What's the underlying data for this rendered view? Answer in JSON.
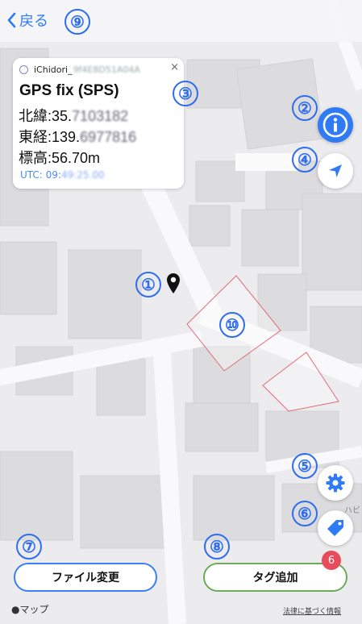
{
  "nav": {
    "back_label": "戻る"
  },
  "card": {
    "device_name": "iChidori_",
    "device_id_masked": "9f4E8D51A04A",
    "close_symbol": "×",
    "title": "GPS fix (SPS)",
    "lat_label": "北緯:",
    "lat_visible": "35.",
    "lat_masked": "7103182",
    "lon_label": "東経:",
    "lon_visible": "139.",
    "lon_masked": "6977816",
    "alt_label": "標高:",
    "alt_value": "56.70m",
    "utc_label": "UTC: 09:",
    "utc_masked": "49:25.00"
  },
  "badges": {
    "b1": "①",
    "b2": "②",
    "b3": "③",
    "b4": "④",
    "b5": "⑤",
    "b6": "⑥",
    "b7": "⑦",
    "b8": "⑧",
    "b9": "⑨",
    "b10": "⑩"
  },
  "buttons": {
    "file_change": "ファイル変更",
    "tag_add": "タグ追加",
    "tag_count": "6"
  },
  "footer": {
    "maps": "マップ",
    "legal": "法律に基づく情報"
  },
  "map": {
    "partial_label": "ハビル"
  },
  "icons": {
    "back": "chevron-left-icon",
    "info": "info-icon",
    "locate": "location-arrow-icon",
    "settings": "gear-icon",
    "tag": "tag-icon",
    "pin": "map-pin-icon"
  },
  "colors": {
    "accent_blue": "#2f7bf5",
    "badge_blue": "#2f6df0",
    "tag_green": "#6bab5a",
    "count_red": "#e74c5c",
    "polygon": "#e06a78"
  }
}
